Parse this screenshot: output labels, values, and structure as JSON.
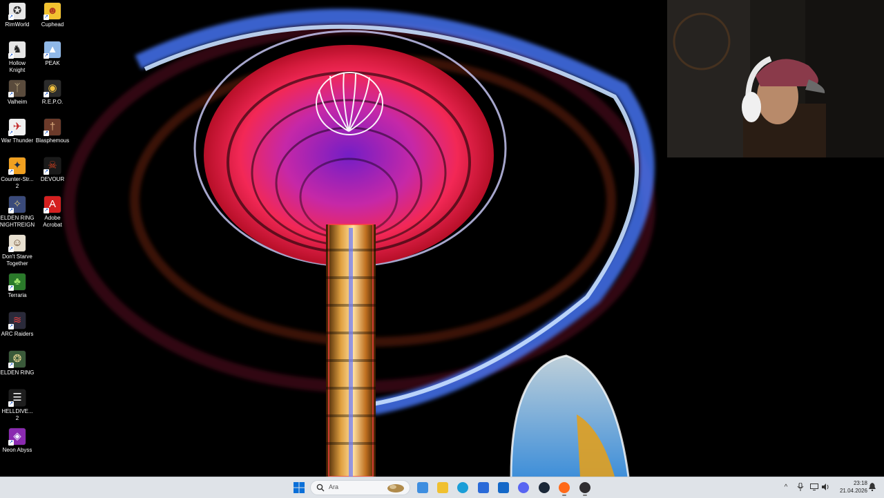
{
  "desktop": {
    "icons": [
      {
        "label": "RimWorld",
        "color": "#e8e8e8",
        "accent": "#333333",
        "glyph": "✪"
      },
      {
        "label": "Cuphead",
        "color": "#f2c230",
        "accent": "#b33a1e",
        "glyph": "☻"
      },
      {
        "label": "Hollow\nKnight",
        "color": "#e6e6e6",
        "accent": "#222222",
        "glyph": "♞"
      },
      {
        "label": "PEAK",
        "color": "#8fb8e8",
        "accent": "#ffffff",
        "glyph": "▲"
      },
      {
        "label": "Valheim",
        "color": "#5a4b3c",
        "accent": "#c9b48a",
        "glyph": "ᛉ"
      },
      {
        "label": "R.E.P.O.",
        "color": "#2b2b2b",
        "accent": "#f0c040",
        "glyph": "◉"
      },
      {
        "label": "War Thunder",
        "color": "#f0f0f0",
        "accent": "#c02020",
        "glyph": "✈"
      },
      {
        "label": "Blasphemous",
        "color": "#6b3a2a",
        "accent": "#e0b080",
        "glyph": "†"
      },
      {
        "label": "Counter-Str...\n2",
        "color": "#f0a020",
        "accent": "#1b2a44",
        "glyph": "✦"
      },
      {
        "label": "DEVOUR",
        "color": "#1a1a1a",
        "accent": "#d04020",
        "glyph": "☠"
      },
      {
        "label": "ELDEN RING\nNIGHTREIGN",
        "color": "#3a4a7a",
        "accent": "#d0c080",
        "glyph": "✧"
      },
      {
        "label": "Adobe\nAcrobat",
        "color": "#d42020",
        "accent": "#ffffff",
        "glyph": "A"
      },
      {
        "label": "Don't Starve\nTogether",
        "color": "#e8e0d0",
        "accent": "#5a3a20",
        "glyph": "☺"
      },
      {
        "label": "Terraria",
        "color": "#2a7a2a",
        "accent": "#9be06a",
        "glyph": "♣"
      },
      {
        "label": "ARC Raiders",
        "color": "#2a2a3a",
        "accent": "#e04040",
        "glyph": "≋"
      },
      {
        "label": "ELDEN RING",
        "color": "#3a5a3a",
        "accent": "#e0d090",
        "glyph": "❂"
      },
      {
        "label": "HELLDIVE...\n2",
        "color": "#1e1e1e",
        "accent": "#ffffff",
        "glyph": "☰"
      },
      {
        "label": "Neon Abyss",
        "color": "#8a2ab0",
        "accent": "#f0f0ff",
        "glyph": "◈"
      }
    ]
  },
  "taskbar": {
    "search_placeholder": "Ara",
    "start_icon": "windows-start-icon",
    "pinned": [
      {
        "name": "widgets-app",
        "color": "#3e8ee0"
      },
      {
        "name": "file-explorer",
        "color": "#f0c030"
      },
      {
        "name": "edge-browser",
        "color": "#1a9ed8"
      },
      {
        "name": "microsoft-store",
        "color": "#2a6ad8"
      },
      {
        "name": "outlook",
        "color": "#1468c8"
      },
      {
        "name": "discord",
        "color": "#5865f2"
      },
      {
        "name": "steam",
        "color": "#1b2838"
      },
      {
        "name": "firefox",
        "color": "#ff6a1a"
      },
      {
        "name": "obs-studio",
        "color": "#302e31"
      }
    ],
    "clock": {
      "time": "23:18",
      "date": "21.04.2026"
    }
  },
  "colors": {
    "taskbar_bg": "#dfe3e8",
    "accent": "#0067c0"
  }
}
